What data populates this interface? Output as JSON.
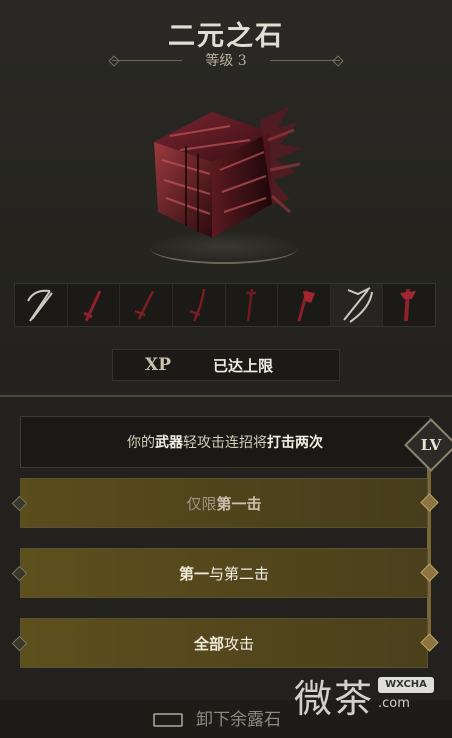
{
  "item": {
    "title": "二元之石",
    "level_text": "等级 3"
  },
  "weapons": [
    {
      "icon": "scythe-icon",
      "highlighted": false
    },
    {
      "icon": "dagger-icon",
      "highlighted": false
    },
    {
      "icon": "sword-icon",
      "highlighted": false
    },
    {
      "icon": "katana-icon",
      "highlighted": false
    },
    {
      "icon": "spear-icon",
      "highlighted": false
    },
    {
      "icon": "axe-icon",
      "highlighted": false
    },
    {
      "icon": "bow-icon",
      "highlighted": true
    },
    {
      "icon": "greatsword-icon",
      "highlighted": false
    }
  ],
  "xp": {
    "label": "XP",
    "status": "已达上限"
  },
  "description": {
    "p1": "你的",
    "b1": "武器",
    "p2": "轻攻击连招将",
    "b2": "打击两次"
  },
  "lv_badge": "LV",
  "options": [
    {
      "plain": "仅限",
      "bold": "第一击",
      "suffix": ""
    },
    {
      "plain": "",
      "bold": "第一",
      "suffix": "与第二击"
    },
    {
      "plain": "",
      "bold": "全部",
      "suffix": "攻击"
    }
  ],
  "footer": {
    "unequip_label": "卸下余露石"
  },
  "watermark": {
    "text": "微茶",
    "badge": "WXCHA",
    "url": ".com"
  },
  "colors": {
    "accent_gold": "#8c7540",
    "stone_red": "#8a2a30"
  }
}
